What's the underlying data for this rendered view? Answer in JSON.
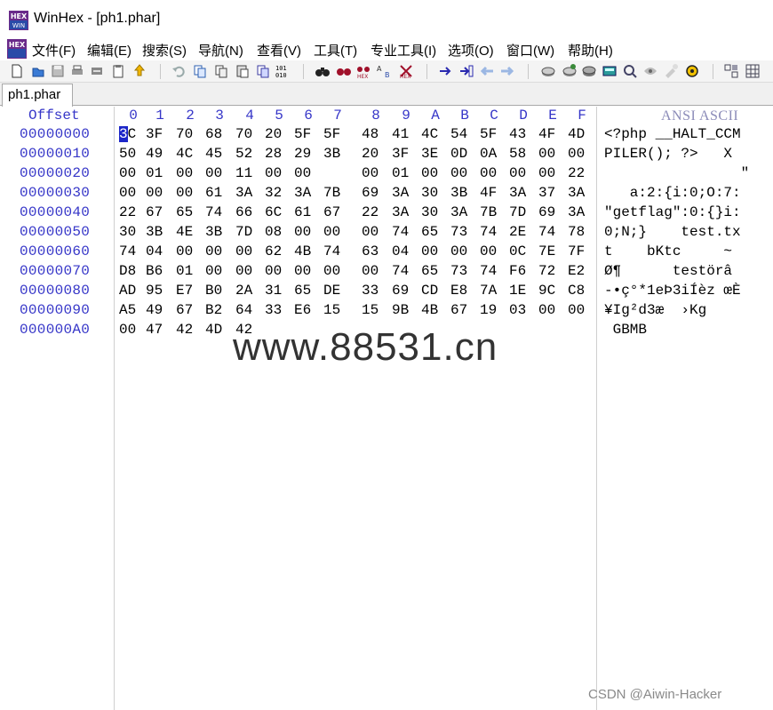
{
  "window": {
    "title": "WinHex - [ph1.phar]"
  },
  "menu": {
    "items": [
      "文件(F)",
      "编辑(E)",
      "搜索(S)",
      "导航(N)",
      "查看(V)",
      "工具(T)",
      "专业工具(I)",
      "选项(O)",
      "窗口(W)",
      "帮助(H)"
    ]
  },
  "toolbar": {
    "icons": [
      "new-file-icon",
      "open-file-icon",
      "save-icon",
      "print-icon",
      "properties-icon",
      "clipboard-icon",
      "upload-icon",
      "undo-icon",
      "copy-icon",
      "copy-block-icon",
      "paste-icon",
      "paste-block-icon",
      "binary-icon",
      "find-icon",
      "find-hex-icon",
      "replace-icon",
      "replace-hex-icon",
      "goto-offset-icon",
      "goto-marker-icon",
      "back-icon",
      "forward-icon",
      "disk-icon",
      "ram-icon",
      "drive-icon",
      "calculator-icon",
      "search-disk-icon",
      "settings-icon",
      "gear-icon",
      "tools-icon",
      "view-icon"
    ]
  },
  "tabs": [
    {
      "label": "ph1.phar",
      "active": true
    }
  ],
  "hex": {
    "offset_header": "Offset",
    "column_headers": [
      "0",
      "1",
      "2",
      "3",
      "4",
      "5",
      "6",
      "7",
      "8",
      "9",
      "A",
      "B",
      "C",
      "D",
      "E",
      "F"
    ],
    "ascii_header": "ANSI ASCII",
    "cursor": {
      "row": 0,
      "col": 0
    },
    "rows": [
      {
        "offset": "00000000",
        "bytes": [
          "3C",
          "3F",
          "70",
          "68",
          "70",
          "20",
          "5F",
          "5F",
          "48",
          "41",
          "4C",
          "54",
          "5F",
          "43",
          "4F",
          "4D"
        ],
        "ascii": "<?php __HALT_CCM"
      },
      {
        "offset": "00000010",
        "bytes": [
          "50",
          "49",
          "4C",
          "45",
          "52",
          "28",
          "29",
          "3B",
          "20",
          "3F",
          "3E",
          "0D",
          "0A",
          "58",
          "00",
          "00"
        ],
        "ascii": "PILER(); ?>   X"
      },
      {
        "offset": "00000020",
        "bytes": [
          "00",
          "01",
          "00",
          "00",
          "11",
          "00",
          "00",
          "",
          "00",
          "01",
          "00",
          "00",
          "00",
          "00",
          "00",
          "22"
        ],
        "ascii": "                \""
      },
      {
        "offset": "00000030",
        "bytes": [
          "00",
          "00",
          "00",
          "61",
          "3A",
          "32",
          "3A",
          "7B",
          "69",
          "3A",
          "30",
          "3B",
          "4F",
          "3A",
          "37",
          "3A"
        ],
        "ascii": "   a:2:{i:0;O:7:"
      },
      {
        "offset": "00000040",
        "bytes": [
          "22",
          "67",
          "65",
          "74",
          "66",
          "6C",
          "61",
          "67",
          "22",
          "3A",
          "30",
          "3A",
          "7B",
          "7D",
          "69",
          "3A"
        ],
        "ascii": "\"getflag\":0:{}i:"
      },
      {
        "offset": "00000050",
        "bytes": [
          "30",
          "3B",
          "4E",
          "3B",
          "7D",
          "08",
          "00",
          "00",
          "00",
          "74",
          "65",
          "73",
          "74",
          "2E",
          "74",
          "78"
        ],
        "ascii": "0;N;}    test.tx"
      },
      {
        "offset": "00000060",
        "bytes": [
          "74",
          "04",
          "00",
          "00",
          "00",
          "62",
          "4B",
          "74",
          "63",
          "04",
          "00",
          "00",
          "00",
          "0C",
          "7E",
          "7F"
        ],
        "ascii": "t    bKtc     ~"
      },
      {
        "offset": "00000070",
        "bytes": [
          "D8",
          "B6",
          "01",
          "00",
          "00",
          "00",
          "00",
          "00",
          "00",
          "74",
          "65",
          "73",
          "74",
          "F6",
          "72",
          "E2"
        ],
        "ascii": "Ø¶      testörâ"
      },
      {
        "offset": "00000080",
        "bytes": [
          "AD",
          "95",
          "E7",
          "B0",
          "2A",
          "31",
          "65",
          "DE",
          "33",
          "69",
          "CD",
          "E8",
          "7A",
          "1E",
          "9C",
          "C8"
        ],
        "ascii": "-•ç°*1eÞ3iÍèz œÈ"
      },
      {
        "offset": "00000090",
        "bytes": [
          "A5",
          "49",
          "67",
          "B2",
          "64",
          "33",
          "E6",
          "15",
          "15",
          "9B",
          "4B",
          "67",
          "19",
          "03",
          "00",
          "00"
        ],
        "ascii": "¥Ig²d3æ  ›Kg"
      },
      {
        "offset": "000000A0",
        "bytes": [
          "00",
          "47",
          "42",
          "4D",
          "42",
          "",
          "",
          "",
          "",
          "",
          "",
          "",
          "",
          "",
          "",
          ""
        ],
        "ascii": " GBMB"
      }
    ]
  },
  "overlay": {
    "watermark": "www.88531.cn",
    "credit": "CSDN @Aiwin-Hacker"
  },
  "colors": {
    "offset_blue": "#3636c8",
    "cursor_blue": "#1c26c8"
  }
}
